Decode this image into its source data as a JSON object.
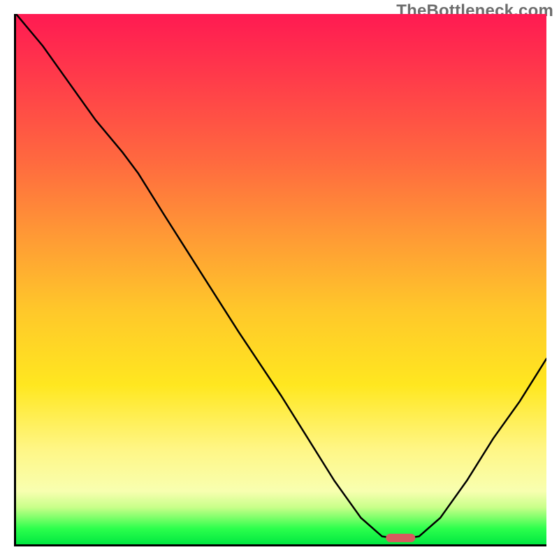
{
  "watermark": "TheBottleneck.com",
  "chart_data": {
    "type": "line",
    "title": "",
    "xlabel": "",
    "ylabel": "",
    "x": [
      0.0,
      0.05,
      0.1,
      0.15,
      0.2,
      0.23,
      0.28,
      0.35,
      0.42,
      0.5,
      0.55,
      0.6,
      0.65,
      0.69,
      0.71,
      0.74,
      0.76,
      0.8,
      0.85,
      0.9,
      0.95,
      1.0
    ],
    "values": [
      1.0,
      0.94,
      0.87,
      0.8,
      0.74,
      0.7,
      0.62,
      0.51,
      0.4,
      0.28,
      0.2,
      0.12,
      0.05,
      0.015,
      0.012,
      0.012,
      0.015,
      0.05,
      0.12,
      0.2,
      0.27,
      0.35
    ],
    "marker": {
      "x": 0.725,
      "y": 0.012,
      "color": "#d85a5f"
    },
    "xlim": [
      0,
      1
    ],
    "ylim": [
      0,
      1
    ],
    "background_gradient": [
      "#ff1a52",
      "#ff9a35",
      "#ffe720",
      "#00e840"
    ]
  }
}
